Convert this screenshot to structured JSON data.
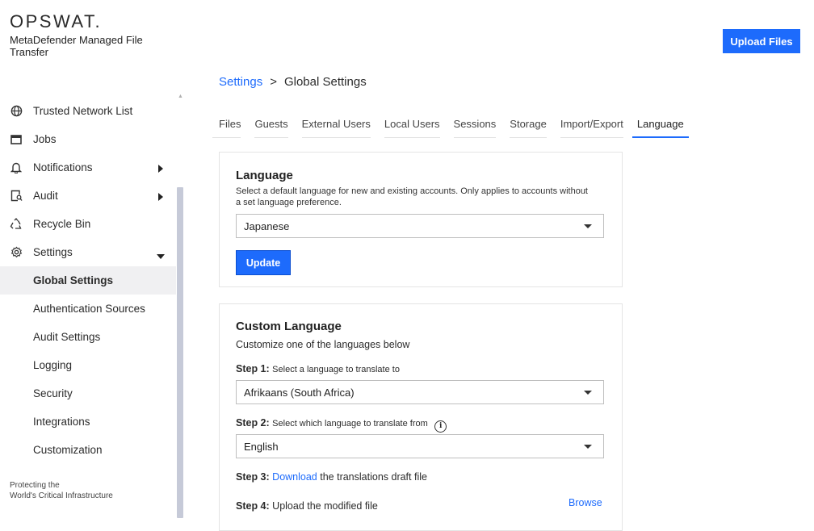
{
  "brand": {
    "wordmark": "OPSWAT.",
    "product": "MetaDefender Managed File Transfer",
    "tagline_line1": "Protecting the",
    "tagline_line2": "World's Critical Infrastructure"
  },
  "header": {
    "upload_label": "Upload Files"
  },
  "sidebar": {
    "items": [
      {
        "label": "Trusted Network List",
        "icon": "globe-icon"
      },
      {
        "label": "Jobs",
        "icon": "window-icon"
      },
      {
        "label": "Notifications",
        "icon": "bell-icon",
        "expandable": true
      },
      {
        "label": "Audit",
        "icon": "audit-icon",
        "expandable": true
      },
      {
        "label": "Recycle Bin",
        "icon": "recycle-icon"
      },
      {
        "label": "Settings",
        "icon": "gear-icon",
        "expanded": true
      }
    ],
    "settings_children": [
      {
        "label": "Global Settings",
        "active": true
      },
      {
        "label": "Authentication Sources"
      },
      {
        "label": "Audit Settings"
      },
      {
        "label": "Logging"
      },
      {
        "label": "Security"
      },
      {
        "label": "Integrations"
      },
      {
        "label": "Customization"
      }
    ]
  },
  "breadcrumb": {
    "root": "Settings",
    "separator": ">",
    "current": "Global Settings"
  },
  "tabs": [
    "Files",
    "Guests",
    "External Users",
    "Local Users",
    "Sessions",
    "Storage",
    "Import/Export",
    "Language"
  ],
  "active_tab": "Language",
  "language_card": {
    "title": "Language",
    "description": "Select a default language for new and existing accounts. Only applies to accounts without a set language preference.",
    "selected": "Japanese",
    "update_label": "Update"
  },
  "custom_card": {
    "title": "Custom Language",
    "subtitle": "Customize one of the languages below",
    "step1_label": "Step 1:",
    "step1_text": "Select a language to translate to",
    "step1_selected": "Afrikaans (South Africa)",
    "step2_label": "Step 2:",
    "step2_text": "Select which language to translate from",
    "step2_selected": "English",
    "step3_label": "Step 3:",
    "step3_link": "Download",
    "step3_text": "the translations draft file",
    "step4_label": "Step 4:",
    "step4_text": "Upload the modified file",
    "browse_label": "Browse"
  },
  "colors": {
    "accent": "#1d6bfc",
    "active_bg": "#f0f0f2",
    "scrollbar": "#c6cad8"
  }
}
